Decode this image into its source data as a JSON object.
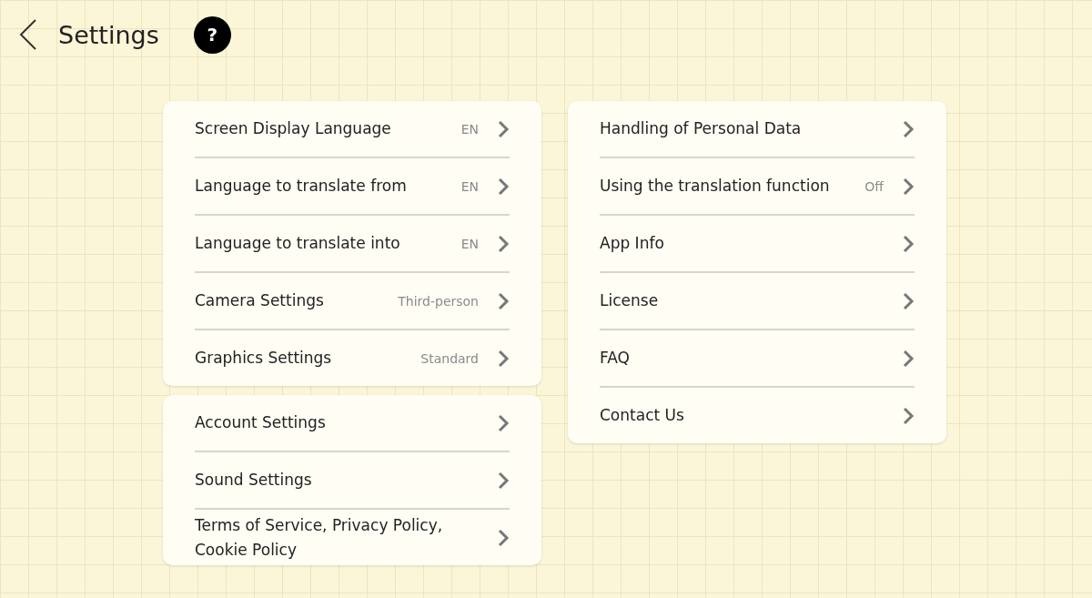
{
  "header": {
    "title": "Settings",
    "help": "?"
  },
  "columns": [
    {
      "cards": [
        {
          "items": [
            {
              "label": "Screen Display Language",
              "value": "EN"
            },
            {
              "label": "Language to translate from",
              "value": "EN"
            },
            {
              "label": "Language to translate into",
              "value": "EN"
            },
            {
              "label": "Camera Settings",
              "value": "Third-person"
            },
            {
              "label": "Graphics Settings",
              "value": "Standard"
            }
          ]
        },
        {
          "items": [
            {
              "label": "Account Settings"
            },
            {
              "label": "Sound Settings"
            },
            {
              "label": "Terms of Service, Privacy Policy, Cookie Policy"
            }
          ]
        }
      ]
    },
    {
      "cards": [
        {
          "items": [
            {
              "label": "Handling of Personal Data"
            },
            {
              "label": "Using the translation function",
              "value": "Off"
            },
            {
              "label": "App Info"
            },
            {
              "label": "License"
            },
            {
              "label": "FAQ"
            },
            {
              "label": "Contact Us"
            }
          ]
        }
      ]
    }
  ]
}
